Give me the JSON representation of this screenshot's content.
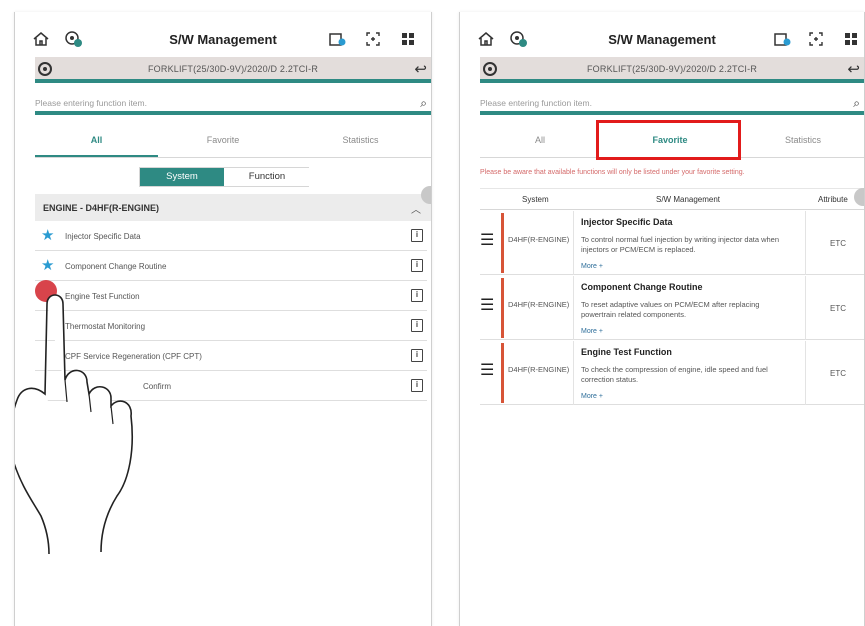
{
  "app_title": "S/W Management",
  "vehicle": "FORKLIFT(25/30D-9V)/2020/D 2.2TCI-R",
  "search_placeholder": "Please entering function item.",
  "tabs": [
    "All",
    "Favorite",
    "Statistics"
  ],
  "segment": {
    "system": "System",
    "function": "Function"
  },
  "engine_header": "ENGINE - D4HF(R-ENGINE)",
  "functions": [
    {
      "label": "Injector Specific Data",
      "favorite": true
    },
    {
      "label": "Component Change Routine",
      "favorite": true
    },
    {
      "label": "Engine Test Function",
      "favorite": false
    },
    {
      "label": "Thermostat Monitoring",
      "favorite": false
    },
    {
      "label": "CPF Service Regeneration (CPF CPT)",
      "favorite": false
    },
    {
      "label": "Confirm",
      "favorite": false
    }
  ],
  "favorite_note": "Please be aware that available functions will only be listed under your favorite setting.",
  "table_headers": {
    "system": "System",
    "sw": "S/W Management",
    "attribute": "Attribute"
  },
  "favorites": [
    {
      "system": "D4HF(R-ENGINE)",
      "name": "Injector Specific Data",
      "desc": "To control normal fuel injection by writing injector data when injectors or PCM/ECM is replaced.",
      "more": "More +",
      "attr": "ETC"
    },
    {
      "system": "D4HF(R-ENGINE)",
      "name": "Component Change Routine",
      "desc": "To reset adaptive values on PCM/ECM after replacing powertrain related components.",
      "more": "More +",
      "attr": "ETC"
    },
    {
      "system": "D4HF(R-ENGINE)",
      "name": "Engine Test Function",
      "desc": "To check the compression of engine, idle speed and fuel correction status.",
      "more": "More +",
      "attr": "ETC"
    }
  ],
  "info_glyph": "i",
  "colors": {
    "teal": "#2e8a83",
    "highlight": "#e21b1b",
    "star": "#2a9bd1",
    "touch": "#d63a41"
  }
}
